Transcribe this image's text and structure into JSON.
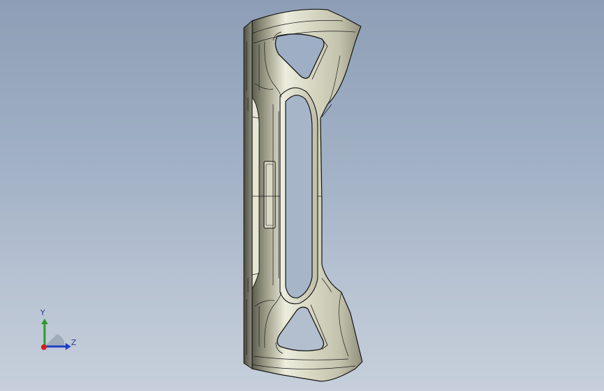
{
  "viewport": {
    "background_top": "#8d9eb6",
    "background_bottom": "#c6cfdb"
  },
  "model": {
    "shell_fill": "#c9c9b3",
    "shell_shadow": "#6f6f5e",
    "edge_color": "#141414"
  },
  "triad": {
    "y_label": "Y",
    "z_label": "Z",
    "y_color": "#2e9a2e",
    "z_color": "#1f3fc7",
    "x_color": "#d21f1f"
  }
}
